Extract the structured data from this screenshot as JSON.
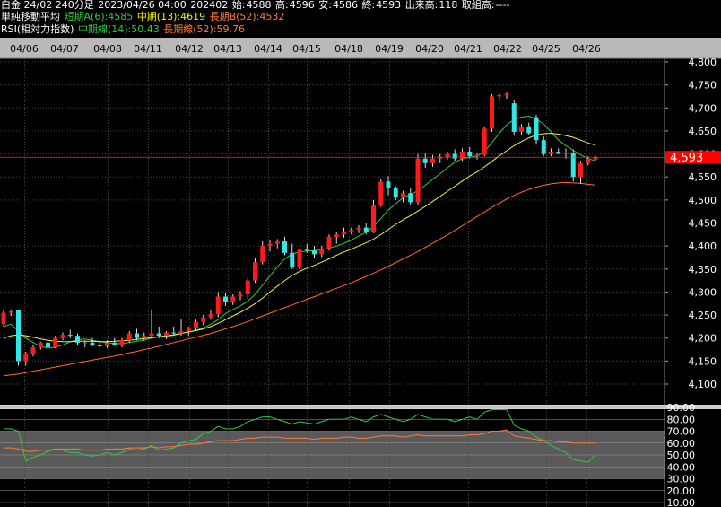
{
  "header": {
    "title": "白金 24/02 240分足",
    "datetime": "2023/04/26 04:00",
    "code": "202402",
    "open_label": "始:",
    "open": "4588",
    "high_label": "高:",
    "high": "4596",
    "low_label": "安:",
    "low": "4586",
    "close_label": "終:",
    "close": "4593",
    "volume_label": "出来高:",
    "volume": "118",
    "oi_label": "取組高:",
    "oi": "----"
  },
  "ma_legend": {
    "title": "単純移動平均",
    "short": "短期A(6):4585",
    "mid": "中期(13):4619",
    "long": "長期B(52):4532"
  },
  "rsi_legend": {
    "title": "RSI(相対力指数)",
    "mid": "中期線(14):50.43",
    "long": "長期線(52):59.76"
  },
  "last_price": "4,593",
  "colors": {
    "up": "#ff1a1a",
    "down": "#33e6e6",
    "ma_short": "#2ecc40",
    "ma_mid": "#f0f04a",
    "ma_long": "#ff6a33",
    "rsi_mid": "#2ecc40",
    "rsi_long": "#ff7a3c",
    "price_tag": "#ff0000",
    "band": "#5a5a5a"
  },
  "chart_data": [
    {
      "type": "candlestick",
      "x_ticks": [
        "04/06",
        "04/07",
        "04/08",
        "04/11",
        "04/12",
        "04/13",
        "04/14",
        "04/15",
        "04/18",
        "04/19",
        "04/20",
        "04/21",
        "04/22",
        "04/25",
        "04/26"
      ],
      "y_ticks": [
        "4,800",
        "4,750",
        "4,700",
        "4,650",
        "4,600",
        "4,550",
        "4,500",
        "4,450",
        "4,400",
        "4,350",
        "4,300",
        "4,250",
        "4,200",
        "4,150",
        "4,100"
      ],
      "ylim": [
        4070,
        4800
      ],
      "candles": [
        [
          4230,
          4262,
          4225,
          4255
        ],
        [
          4255,
          4262,
          4248,
          4258
        ],
        [
          4260,
          4262,
          4140,
          4150
        ],
        [
          4150,
          4170,
          4140,
          4165
        ],
        [
          4165,
          4185,
          4160,
          4180
        ],
        [
          4180,
          4192,
          4175,
          4190
        ],
        [
          4190,
          4195,
          4175,
          4180
        ],
        [
          4180,
          4205,
          4178,
          4200
        ],
        [
          4200,
          4212,
          4195,
          4207
        ],
        [
          4207,
          4218,
          4200,
          4205
        ],
        [
          4205,
          4210,
          4185,
          4190
        ],
        [
          4190,
          4195,
          4180,
          4190
        ],
        [
          4190,
          4200,
          4182,
          4185
        ],
        [
          4185,
          4195,
          4178,
          4182
        ],
        [
          4182,
          4195,
          4178,
          4190
        ],
        [
          4190,
          4200,
          4183,
          4185
        ],
        [
          4185,
          4200,
          4180,
          4195
        ],
        [
          4195,
          4215,
          4190,
          4210
        ],
        [
          4210,
          4220,
          4195,
          4200
        ],
        [
          4200,
          4212,
          4195,
          4205
        ],
        [
          4205,
          4260,
          4200,
          4210
        ],
        [
          4210,
          4225,
          4200,
          4205
        ],
        [
          4205,
          4215,
          4198,
          4212
        ],
        [
          4212,
          4225,
          4205,
          4210
        ],
        [
          4210,
          4242,
          4205,
          4215
        ],
        [
          4215,
          4225,
          4205,
          4222
        ],
        [
          4222,
          4240,
          4215,
          4235
        ],
        [
          4235,
          4250,
          4228,
          4245
        ],
        [
          4245,
          4262,
          4240,
          4252
        ],
        [
          4252,
          4300,
          4245,
          4290
        ],
        [
          4290,
          4298,
          4270,
          4278
        ],
        [
          4278,
          4295,
          4272,
          4290
        ],
        [
          4290,
          4302,
          4282,
          4295
        ],
        [
          4295,
          4330,
          4285,
          4325
        ],
        [
          4325,
          4375,
          4320,
          4365
        ],
        [
          4365,
          4410,
          4360,
          4400
        ],
        [
          4400,
          4412,
          4388,
          4405
        ],
        [
          4405,
          4415,
          4395,
          4410
        ],
        [
          4410,
          4420,
          4380,
          4385
        ],
        [
          4385,
          4405,
          4350,
          4355
        ],
        [
          4355,
          4395,
          4350,
          4392
        ],
        [
          4392,
          4405,
          4385,
          4390
        ],
        [
          4390,
          4400,
          4375,
          4382
        ],
        [
          4382,
          4400,
          4376,
          4395
        ],
        [
          4395,
          4425,
          4390,
          4420
        ],
        [
          4420,
          4430,
          4405,
          4425
        ],
        [
          4425,
          4440,
          4418,
          4432
        ],
        [
          4432,
          4440,
          4425,
          4435
        ],
        [
          4435,
          4445,
          4428,
          4440
        ],
        [
          4440,
          4450,
          4425,
          4430
        ],
        [
          4430,
          4500,
          4428,
          4490
        ],
        [
          4490,
          4545,
          4485,
          4540
        ],
        [
          4540,
          4552,
          4510,
          4525
        ],
        [
          4525,
          4530,
          4500,
          4505
        ],
        [
          4505,
          4520,
          4495,
          4515
        ],
        [
          4515,
          4525,
          4490,
          4495
        ],
        [
          4495,
          4600,
          4490,
          4590
        ],
        [
          4590,
          4602,
          4570,
          4580
        ],
        [
          4580,
          4598,
          4572,
          4590
        ],
        [
          4590,
          4600,
          4580,
          4593
        ],
        [
          4593,
          4605,
          4588,
          4600
        ],
        [
          4600,
          4610,
          4585,
          4590
        ],
        [
          4590,
          4612,
          4585,
          4605
        ],
        [
          4605,
          4615,
          4590,
          4595
        ],
        [
          4595,
          4602,
          4588,
          4598
        ],
        [
          4598,
          4660,
          4595,
          4655
        ],
        [
          4655,
          4730,
          4648,
          4725
        ],
        [
          4725,
          4732,
          4715,
          4728
        ],
        [
          4728,
          4735,
          4720,
          4730
        ],
        [
          4710,
          4718,
          4640,
          4648
        ],
        [
          4648,
          4665,
          4640,
          4660
        ],
        [
          4660,
          4668,
          4640,
          4645
        ],
        [
          4680,
          4685,
          4620,
          4630
        ],
        [
          4630,
          4638,
          4595,
          4600
        ],
        [
          4600,
          4612,
          4595,
          4605
        ],
        [
          4605,
          4612,
          4600,
          4600
        ],
        [
          4600,
          4612,
          4590,
          4602
        ],
        [
          4602,
          4610,
          4540,
          4550
        ],
        [
          4550,
          4585,
          4535,
          4580
        ],
        [
          4580,
          4595,
          4575,
          4590
        ],
        [
          4588,
          4596,
          4586,
          4593
        ]
      ],
      "ma": [
        {
          "name": "短期A(6)",
          "values": [
            4225,
            4230,
            4215,
            4200,
            4190,
            4182,
            4178,
            4180,
            4185,
            4192,
            4196,
            4198,
            4195,
            4192,
            4190,
            4188,
            4188,
            4190,
            4193,
            4195,
            4200,
            4203,
            4204,
            4206,
            4210,
            4213,
            4217,
            4222,
            4230,
            4240,
            4253,
            4262,
            4270,
            4280,
            4295,
            4315,
            4335,
            4355,
            4372,
            4383,
            4387,
            4389,
            4390,
            4392,
            4395,
            4400,
            4406,
            4413,
            4422,
            4430,
            4442,
            4460,
            4478,
            4492,
            4505,
            4512,
            4520,
            4532,
            4545,
            4557,
            4570,
            4582,
            4590,
            4593,
            4596,
            4605,
            4625,
            4645,
            4663,
            4675,
            4680,
            4682,
            4676,
            4665,
            4648,
            4630,
            4618,
            4608,
            4598,
            4590,
            4585
          ]
        },
        {
          "name": "中期(13)",
          "values": [
            4200,
            4205,
            4207,
            4205,
            4202,
            4198,
            4195,
            4193,
            4192,
            4192,
            4193,
            4193,
            4193,
            4192,
            4192,
            4193,
            4194,
            4195,
            4197,
            4199,
            4201,
            4203,
            4205,
            4207,
            4210,
            4213,
            4216,
            4220,
            4225,
            4232,
            4240,
            4248,
            4256,
            4265,
            4275,
            4287,
            4300,
            4313,
            4325,
            4336,
            4345,
            4352,
            4358,
            4365,
            4372,
            4380,
            4387,
            4393,
            4400,
            4407,
            4415,
            4425,
            4436,
            4447,
            4457,
            4466,
            4476,
            4486,
            4497,
            4508,
            4519,
            4530,
            4541,
            4552,
            4561,
            4572,
            4584,
            4596,
            4607,
            4618,
            4627,
            4635,
            4641,
            4644,
            4645,
            4643,
            4640,
            4636,
            4630,
            4624,
            4619
          ]
        },
        {
          "name": "長期B(52)",
          "values": [
            4118,
            4120,
            4122,
            4125,
            4128,
            4131,
            4134,
            4137,
            4140,
            4143,
            4146,
            4149,
            4152,
            4155,
            4158,
            4161,
            4164,
            4168,
            4171,
            4175,
            4178,
            4182,
            4186,
            4190,
            4194,
            4198,
            4202,
            4206,
            4210,
            4215,
            4220,
            4225,
            4230,
            4236,
            4242,
            4248,
            4254,
            4260,
            4266,
            4272,
            4278,
            4284,
            4290,
            4296,
            4302,
            4308,
            4314,
            4320,
            4327,
            4334,
            4341,
            4348,
            4356,
            4364,
            4372,
            4380,
            4388,
            4397,
            4406,
            4415,
            4424,
            4434,
            4444,
            4454,
            4464,
            4474,
            4484,
            4493,
            4502,
            4510,
            4517,
            4523,
            4528,
            4532,
            4535,
            4537,
            4538,
            4537,
            4536,
            4534,
            4532
          ]
        }
      ]
    },
    {
      "type": "line",
      "y_ticks": [
        "90.00",
        "80.00",
        "70.00",
        "60.00",
        "50.00",
        "40.00",
        "30.00",
        "20.00",
        "10.00"
      ],
      "ylim": [
        10,
        90
      ],
      "band": [
        30,
        70
      ],
      "series": [
        {
          "name": "中期線(14)",
          "values": [
            72,
            72,
            70,
            45,
            48,
            50,
            53,
            55,
            54,
            52,
            52,
            50,
            49,
            50,
            52,
            50,
            52,
            55,
            54,
            55,
            58,
            54,
            55,
            56,
            60,
            62,
            63,
            68,
            70,
            74,
            72,
            72,
            74,
            78,
            80,
            82,
            82,
            80,
            78,
            76,
            78,
            77,
            76,
            78,
            80,
            80,
            80,
            82,
            80,
            78,
            82,
            84,
            82,
            80,
            78,
            80,
            84,
            82,
            80,
            80,
            80,
            78,
            80,
            82,
            80,
            86,
            88,
            88,
            88,
            75,
            72,
            70,
            65,
            62,
            58,
            55,
            52,
            46,
            45,
            44,
            50
          ]
        },
        {
          "name": "長期線(52)",
          "values": [
            56,
            56,
            55,
            53,
            53,
            54,
            54,
            55,
            55,
            55,
            55,
            54,
            54,
            54,
            55,
            55,
            55,
            56,
            56,
            56,
            57,
            56,
            57,
            57,
            58,
            59,
            59,
            60,
            61,
            62,
            62,
            62,
            63,
            64,
            64,
            65,
            65,
            65,
            64,
            64,
            64,
            64,
            63,
            64,
            64,
            64,
            65,
            65,
            64,
            64,
            65,
            66,
            66,
            66,
            65,
            66,
            67,
            66,
            66,
            66,
            66,
            66,
            66,
            67,
            67,
            68,
            70,
            70,
            71,
            66,
            65,
            64,
            63,
            62,
            62,
            61,
            61,
            60,
            60,
            60,
            60
          ]
        }
      ]
    }
  ]
}
